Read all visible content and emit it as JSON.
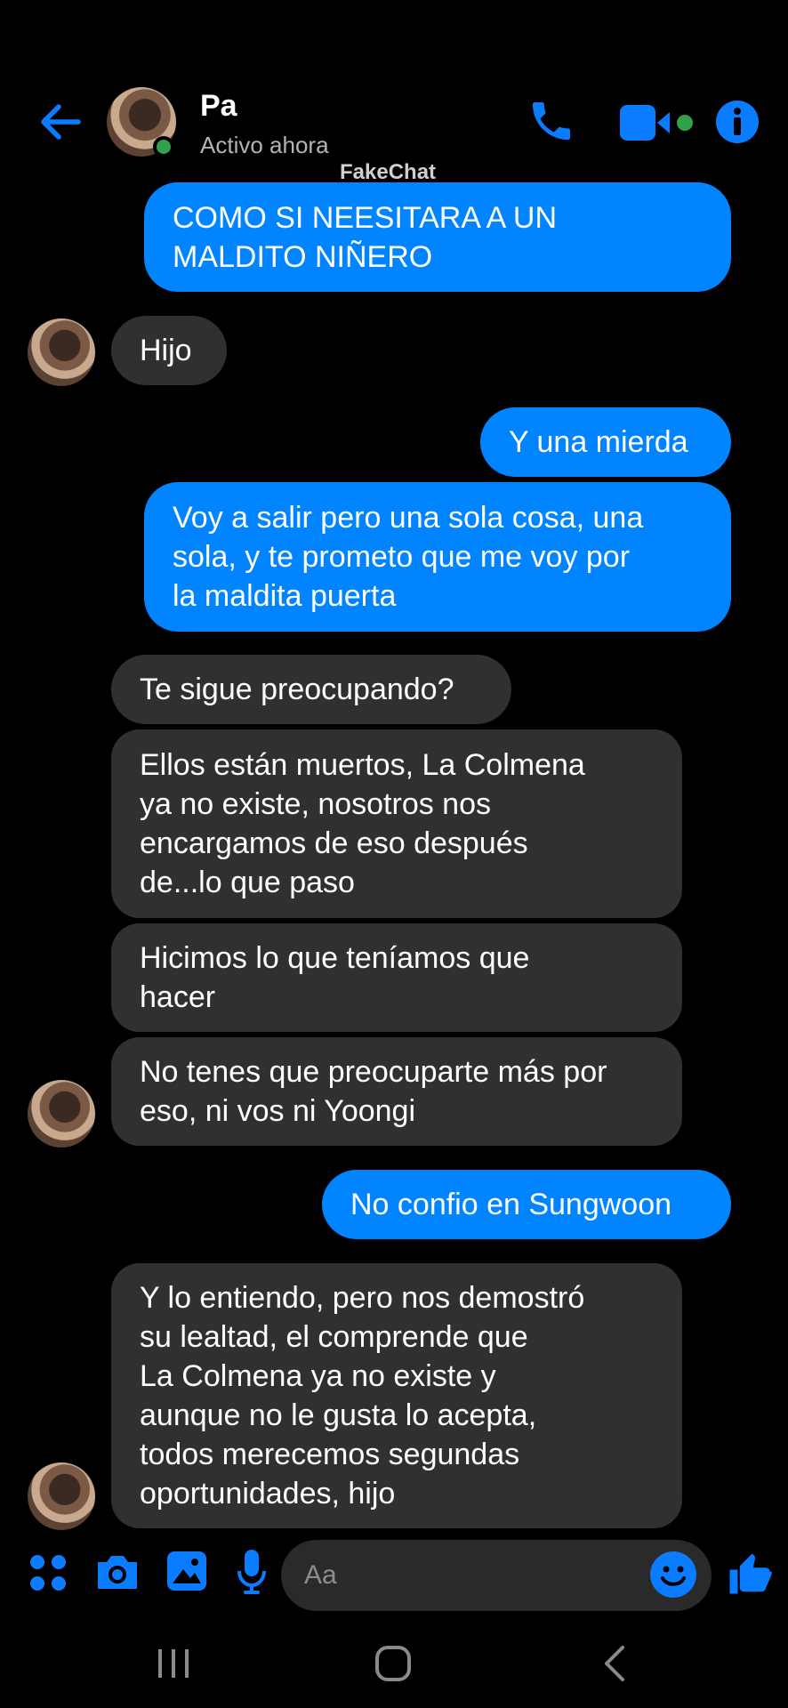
{
  "header": {
    "contact_name": "Pa",
    "contact_status": "Activo ahora",
    "watermark": "FakeChat",
    "icons": [
      "back-arrow-icon",
      "phone-icon",
      "video-camera-icon",
      "info-icon"
    ],
    "accent_color": "#0084ff",
    "online_color": "#31a24c"
  },
  "messages": [
    {
      "from": "me",
      "text": "COMO SI NEESITARA A UN\nMALDITO NIÑERO"
    },
    {
      "from": "contact",
      "text": "Hijo"
    },
    {
      "from": "me",
      "text": "Y una mierda"
    },
    {
      "from": "me",
      "text": "Voy a salir pero una sola cosa, una\nsola, y te prometo que me voy por\nla maldita puerta"
    },
    {
      "from": "contact",
      "text": "Te sigue preocupando?"
    },
    {
      "from": "contact",
      "text": "Ellos están muertos, La Colmena\nya no existe, nosotros nos\nencargamos de eso después\nde...lo que paso"
    },
    {
      "from": "contact",
      "text": "Hicimos lo que teníamos que\nhacer"
    },
    {
      "from": "contact",
      "text": "No tenes que preocuparte más por\neso, ni vos ni Yoongi"
    },
    {
      "from": "me",
      "text": "No confio en Sungwoon"
    },
    {
      "from": "contact",
      "text": "Y lo entiendo, pero nos demostró\nsu lealtad, el comprende que\nLa Colmena ya no existe y\naunque no le gusta lo acepta,\ntodos merecemos segundas\noportunidades, hijo"
    }
  ],
  "composer": {
    "placeholder": "Aa",
    "icons": [
      "apps-icon",
      "camera-icon",
      "gallery-icon",
      "microphone-icon",
      "emoji-icon",
      "like-icon"
    ]
  },
  "navbar": {
    "icons": [
      "recent-apps-icon",
      "home-icon",
      "back-icon"
    ]
  }
}
